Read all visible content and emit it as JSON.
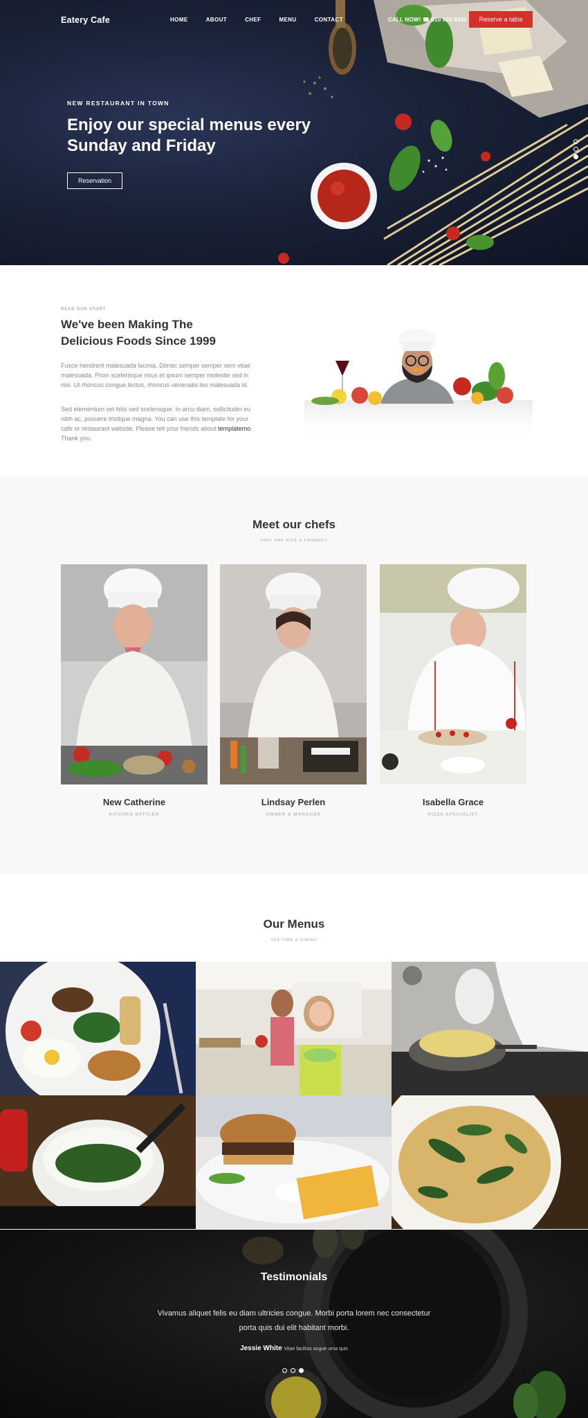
{
  "header": {
    "logo": "Eatery   Cafe",
    "nav": [
      "HOME",
      "ABOUT",
      "CHEF",
      "MENU",
      "CONTACT"
    ],
    "call": "CALL NOW! ☎ 010 020 0340",
    "reserve": "Reserve a table"
  },
  "hero": {
    "kicker": "NEW RESTAURANT IN TOWN",
    "title": "Enjoy our special menus every Sunday and Friday",
    "button": "Reservation",
    "slides": 3,
    "active_slide": 3
  },
  "story": {
    "kicker": "READ OUR STORY",
    "title": "We've been Making The Delicious Foods Since 1999",
    "p1": "Fusce hendrerit malesuada lacinia. Donec semper semper sem vitae malesuada. Proin scelerisque risus et ipsum semper molestie sed in nisi. Ut rhoncus congue lectus, rhoncus venenatis leo malesuada id.",
    "p2_before": "Sed elementum vel felis sed scelerisque. In arcu diam, sollicitudin eu nibh ac, posuere tristique magna. You can use this template for your cafe or restaurant website. Please tell your friends about ",
    "p2_link": "templatemo",
    "p2_after": ". Thank you."
  },
  "chefs": {
    "title": "Meet our chefs",
    "subtitle": "THEY ARE NICE & FRIENDLY",
    "items": [
      {
        "name": "New Catherine",
        "role": "KITCHEN OFFICER"
      },
      {
        "name": "Lindsay Perlen",
        "role": "OWNER & MANAGER"
      },
      {
        "name": "Isabella Grace",
        "role": "PIZZA SPECIALIST"
      }
    ]
  },
  "menus": {
    "title": "Our Menus",
    "subtitle": "TEA TIME & DINING"
  },
  "testimonials": {
    "title": "Testimonials",
    "quote": "Vivamus aliquet felis eu diam ultricies congue. Morbi porta lorem nec consectetur porta quis dui elit habitant morbi.",
    "author": "Jessie White",
    "author_note": "Vitae facilisis augue urna quis"
  },
  "colors": {
    "accent": "#d6302b",
    "hero_bg": "#1a2238",
    "footer_bg": "#141414"
  }
}
